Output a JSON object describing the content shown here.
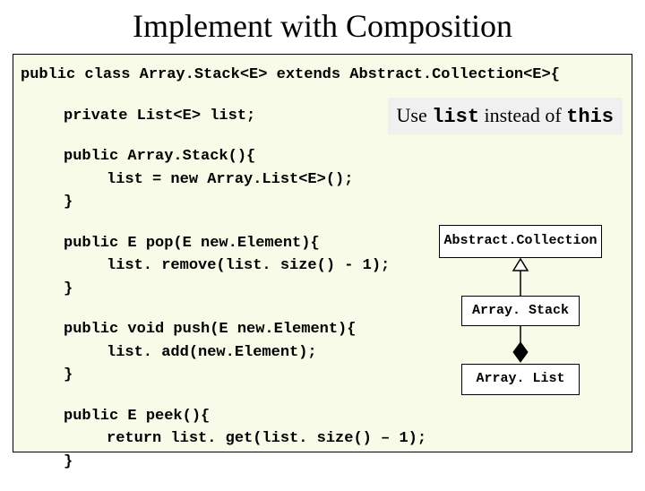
{
  "title": "Implement with Composition",
  "tip": {
    "pre": "Use ",
    "code1": "list",
    "mid": " instead of ",
    "code2": "this"
  },
  "code": {
    "l1": "public class Array.Stack<E> extends Abstract.Collection<E>{",
    "l2": "private List<E> list;",
    "l3": "public Array.Stack(){",
    "l4": "list = new Array.List<E>();",
    "l5": "}",
    "l6": "public E pop(E new.Element){",
    "l7": "list. remove(list. size() - 1);",
    "l8": "}",
    "l9": "public void push(E new.Element){",
    "l10": "list. add(new.Element);",
    "l11": "}",
    "l12": "public E peek(){",
    "l13": "return list. get(list. size() – 1);",
    "l14": "}"
  },
  "uml": {
    "top": "Abstract.Collection",
    "mid": "Array. Stack",
    "bot": "Array. List"
  }
}
